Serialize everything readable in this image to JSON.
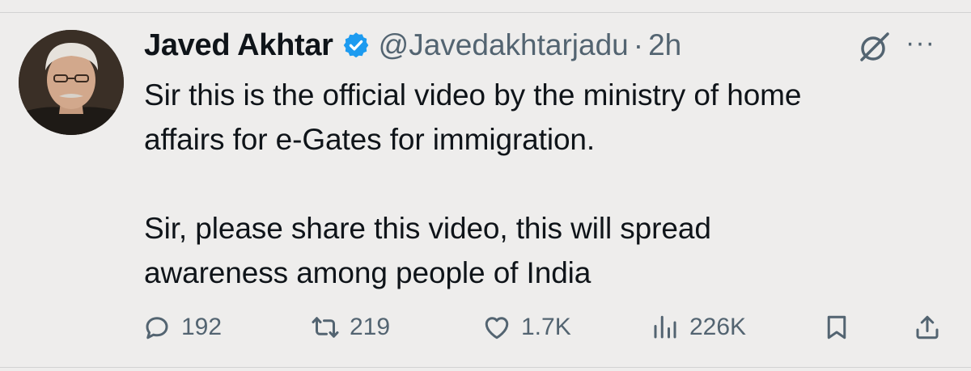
{
  "tweet": {
    "author_name": "Javed Akhtar",
    "handle": "@Javedakhtarjadu",
    "separator": "·",
    "time": "2h",
    "more_label": "···",
    "lines": [
      "Sir this is the official video by the ministry of home",
      "affairs for e-Gates for immigration.",
      "Sir, please share this video, this will spread",
      "awareness among people of India"
    ]
  },
  "actions": {
    "replies": "192",
    "reposts": "219",
    "likes": "1.7K",
    "views": "226K"
  },
  "colors": {
    "background": "#eeedec",
    "text": "#0f1419",
    "muted": "#536471",
    "verified": "#1d9bf0"
  },
  "icons": [
    "verified-badge-icon",
    "grok-icon",
    "more-icon",
    "reply-icon",
    "repost-icon",
    "like-icon",
    "views-icon",
    "bookmark-icon",
    "share-icon"
  ]
}
